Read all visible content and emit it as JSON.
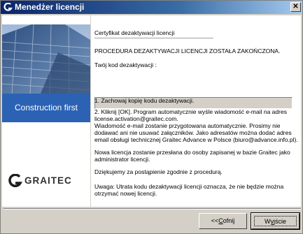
{
  "window": {
    "title": "Menedżer licencji",
    "close_glyph": "✕"
  },
  "banner": {
    "tagline": "Construction first",
    "brand_name": "GRAITEC",
    "brand_letter": "G"
  },
  "panel": {
    "heading": "Certyfikat dezaktywacji licencji",
    "status": "PROCEDURA DEZAKTYWACJI LICENCJI ZOSTAŁA ZAKOŃCZONA.",
    "code_label": "Twój kod dezaktywacji :",
    "code_value": "",
    "step1": "1. Zachowaj kopię kodu dezaktywacji.",
    "step2_line1": "2. Kliknij [OK]. Program automatycznie wyśle wiadomość e-mail na adres",
    "step2_line2": "license.activation@graitec.com.",
    "step2_line3": "Wiadomość e-mail zostanie przygotowana automatycznie. Prosimy nie",
    "step2_line4": "dodawać ani nie usuwać załączników. Jako adresatów można dodać adres",
    "step2_line5": "email obsługi technicznej Graitec Advance w Polsce (biuro@advance.info.pl).",
    "new_license_line1": "Nowa licencja zostanie przesłana do osoby zapisanej w bazie Graitec jako",
    "new_license_line2": "administrator licencji.",
    "thanks": "Dziękujemy za postąpienie zgodnie z procedurą.",
    "warning_line1": "Uwaga: Utrata kodu dezaktywacji licencji oznacza, że nie będzie można",
    "warning_line2": "otrzymać nowej licencji."
  },
  "buttons": {
    "back_prefix": "<<",
    "back_hotkey": "C",
    "back_rest": "ofnij",
    "exit_prefix": "W",
    "exit_hotkey": "y",
    "exit_rest": "jście"
  },
  "colors": {
    "title_start": "#0a246a",
    "title_end": "#a6caf0",
    "banner_blue": "#2b62b4",
    "face": "#d4d0c8"
  }
}
